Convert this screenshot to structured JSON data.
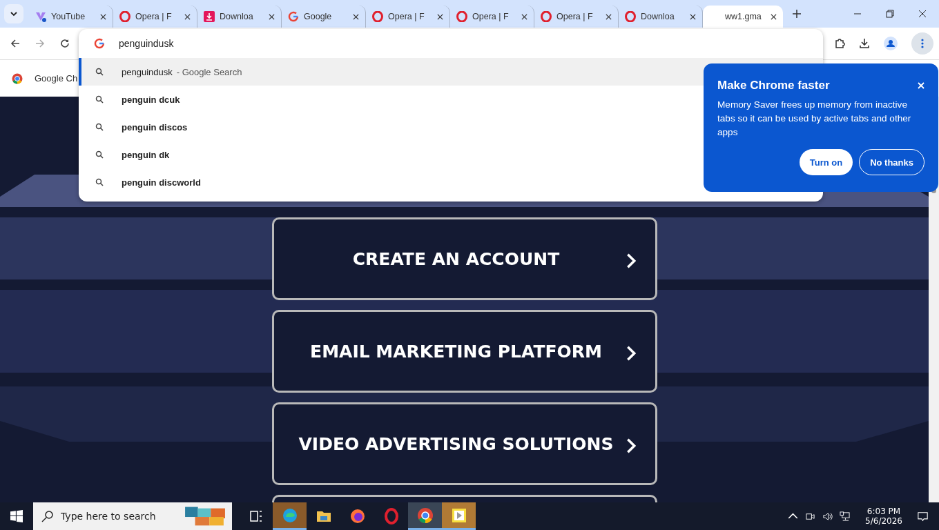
{
  "tabs": [
    {
      "kind": "vivaldi",
      "label": "YouTube",
      "selected": false
    },
    {
      "kind": "opera",
      "label": "Opera | F",
      "selected": false
    },
    {
      "kind": "download",
      "label": "Downloa",
      "selected": false
    },
    {
      "kind": "google",
      "label": "Google",
      "selected": false
    },
    {
      "kind": "opera",
      "label": "Opera | F",
      "selected": false
    },
    {
      "kind": "opera",
      "label": "Opera | F",
      "selected": false
    },
    {
      "kind": "opera",
      "label": "Opera | F",
      "selected": false
    },
    {
      "kind": "opera",
      "label": "Downloa",
      "selected": false
    },
    {
      "kind": "blank",
      "label": "ww1.gma",
      "selected": true
    }
  ],
  "omnibox": {
    "value": "penguindusk"
  },
  "suggestions": [
    {
      "query": "penguindusk",
      "suffix": "- Google Search",
      "selected": true
    },
    {
      "query": "penguin dcuk",
      "selected": false
    },
    {
      "query": "penguin discos",
      "selected": false
    },
    {
      "query": "penguin dk",
      "selected": false
    },
    {
      "query": "penguin discworld",
      "selected": false
    }
  ],
  "bookmarks": [
    "Google Ch"
  ],
  "popup": {
    "title": "Make Chrome faster",
    "body": "Memory Saver frees up memory from inactive tabs so it can be used by active tabs and other apps",
    "buttons": [
      {
        "label": "Turn on",
        "kind": "primary"
      },
      {
        "label": "No thanks",
        "kind": "secondary"
      }
    ]
  },
  "page_buttons": [
    {
      "kind": "link",
      "label": "CREATE AN ACCOUNT"
    },
    {
      "kind": "link",
      "label": "EMAIL MARKETING PLATFORM"
    },
    {
      "kind": "link",
      "label": "VIDEO ADVERTISING SOLUTIONS"
    },
    {
      "kind": "cut"
    }
  ],
  "taskbar": {
    "search_placeholder": "Type here to search",
    "apps": [
      {
        "kind": "taskview",
        "active": false
      },
      {
        "kind": "edge",
        "active": true
      },
      {
        "kind": "folder",
        "active": false
      },
      {
        "kind": "firefox",
        "active": false
      },
      {
        "kind": "opera",
        "active": false
      },
      {
        "kind": "chrome",
        "active": true
      },
      {
        "kind": "player",
        "active": true
      }
    ],
    "time": "6:03 PM",
    "date": "5/6/2026"
  }
}
